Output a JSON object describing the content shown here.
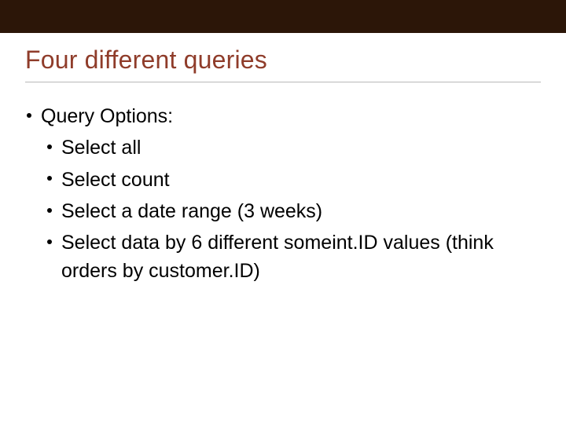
{
  "slide": {
    "title": "Four different queries",
    "bullets": {
      "l1_0": "Query Options:",
      "l2_0": "Select all",
      "l2_1": "Select count",
      "l2_2": "Select a date range (3 weeks)",
      "l2_3": "Select data by 6 different someint.ID values (think orders by customer.ID)"
    }
  }
}
